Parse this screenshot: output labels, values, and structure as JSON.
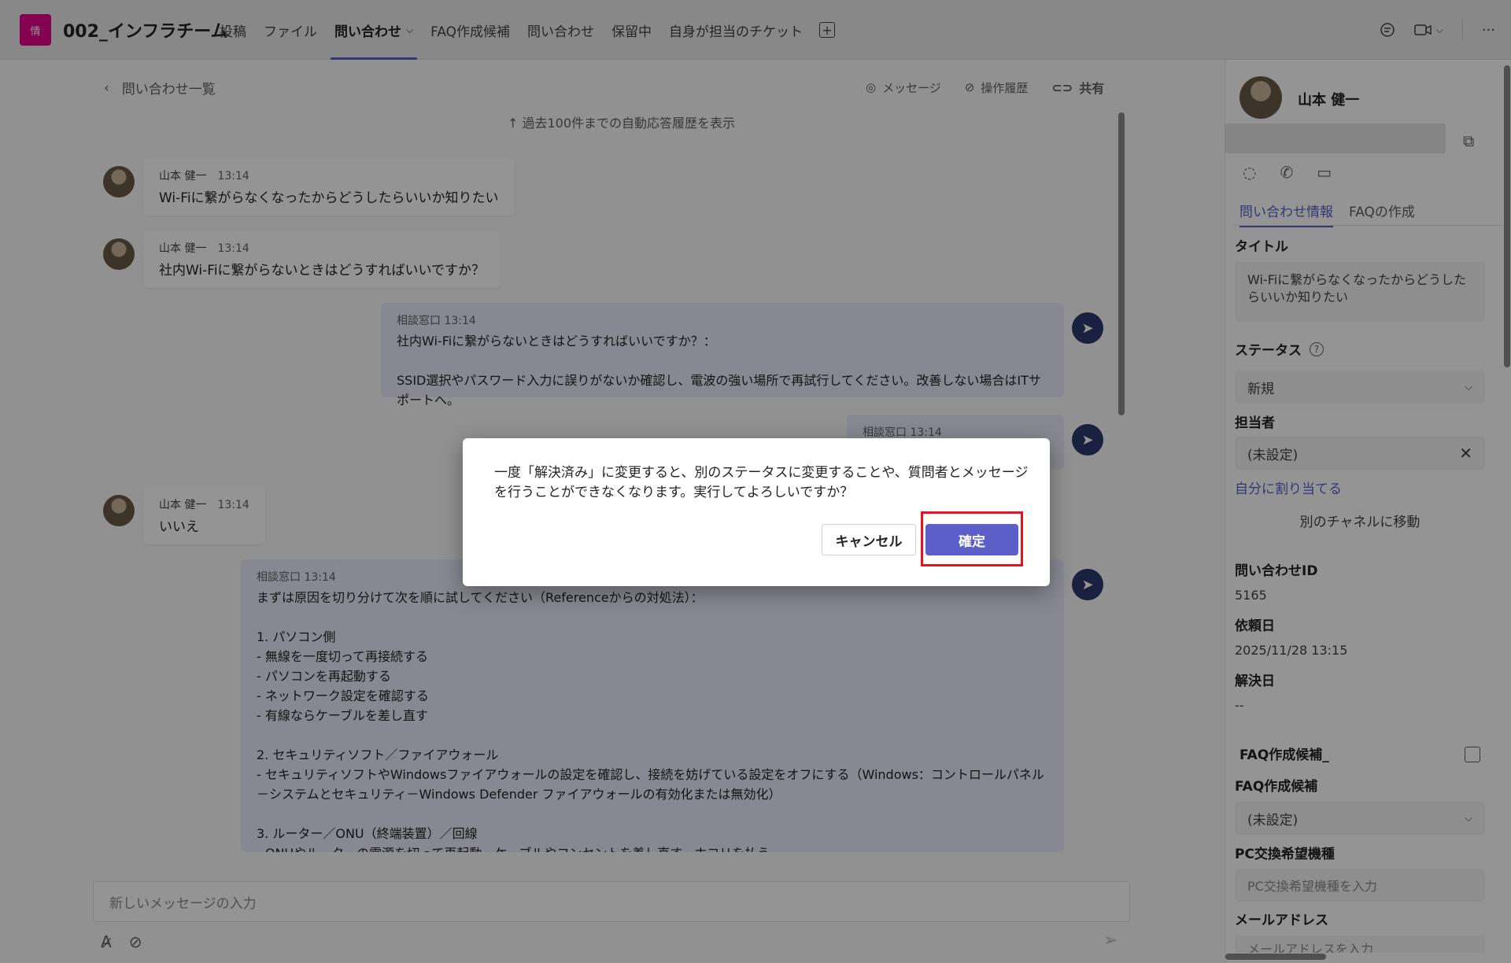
{
  "topbar": {
    "team_icon_text": "情",
    "team_icon_color": "#e3008c",
    "team_name": "002_インフラチーム",
    "tabs": [
      {
        "label": "投稿"
      },
      {
        "label": "ファイル"
      },
      {
        "label": "問い合わせ",
        "active": true
      },
      {
        "label": "FAQ作成候補"
      },
      {
        "label": "問い合わせ"
      },
      {
        "label": "保留中"
      },
      {
        "label": "自身が担当のチケット"
      }
    ]
  },
  "chat": {
    "back_label": "問い合わせ一覧",
    "actions": {
      "message": "メッセージ",
      "history": "操作履歴",
      "share": "共有"
    },
    "history_link": "↑ 過去100件までの自動応答履歴を表示",
    "messages": [
      {
        "sender": "山本 健一",
        "time": "13:14",
        "text": "Wi-Fiに繋がらなくなったからどうしたらいいか知りたい"
      },
      {
        "sender": "山本 健一",
        "time": "13:14",
        "text": "社内Wi-Fiに繋がらないときはどうすればいいですか？"
      },
      {
        "sender": "山本 健一",
        "time": "13:14",
        "text": "いいえ"
      }
    ],
    "bot_messages": [
      {
        "meta": "相談窓口 13:14",
        "text": "社内Wi-Fiに繋がらないときはどうすればいいですか？：\n\nSSID選択やパスワード入力に誤りがないか確認し、電波の強い場所で再試行してください。改善しない場合はITサポートへ。"
      },
      {
        "meta": "相談窓口 13:14",
        "text": ""
      },
      {
        "meta": "相談窓口 13:14",
        "text": "まずは原因を切り分けて次を順に試してください（Referenceからの対処法）：\n\n1. パソコン側\n- 無線を一度切って再接続する\n- パソコンを再起動する\n- ネットワーク設定を確認する\n- 有線ならケーブルを差し直す\n\n2. セキュリティソフト／ファイアウォール\n- セキュリティソフトやWindowsファイアウォールの設定を確認し、接続を妨げている設定をオフにする（Windows：コントロールパネル－システムとセキュリティ－Windows Defender ファイアウォールの有効化または無効化）\n\n3. ルーター／ONU（終端装置）／回線\n- ONUやルーターの電源を切って再起動、ケーブルやコンセントを差し直す、ホコリを払う"
      }
    ],
    "compose_placeholder": "新しいメッセージの入力"
  },
  "side": {
    "name": "山本 健一",
    "tabs": [
      "問い合わせ情報",
      "FAQの作成"
    ],
    "title_label": "タイトル",
    "title_value": "Wi-Fiに繋がらなくなったからどうしたらいいか知りたい",
    "status_label": "ステータス",
    "status_value": "新規",
    "assignee_label": "担当者",
    "assignee_value": "(未設定)",
    "assign_self": "自分に割り当てる",
    "move_channel": "別のチャネルに移動",
    "inquiry_id_label": "問い合わせID",
    "inquiry_id_value": "5165",
    "request_date_label": "依頼日",
    "request_date_value": "2025/11/28 13:15",
    "resolved_date_label": "解決日",
    "resolved_date_value": "--",
    "faq_candidate_check_label": "FAQ作成候補_",
    "faq_candidate_label": "FAQ作成候補",
    "faq_candidate_value": "(未設定)",
    "pc_label": "PC交換希望機種",
    "pc_placeholder": "PC交換希望機種を入力",
    "email_label": "メールアドレス",
    "email_placeholder": "メールアドレスを入力"
  },
  "dialog": {
    "message": "一度「解決済み」に変更すると、別のステータスに変更することや、質問者とメッセージを行うことができなくなります。実行してよろしいですか？",
    "cancel_label": "キャンセル",
    "confirm_label": "確定",
    "highlight_color": "#e3131f"
  }
}
